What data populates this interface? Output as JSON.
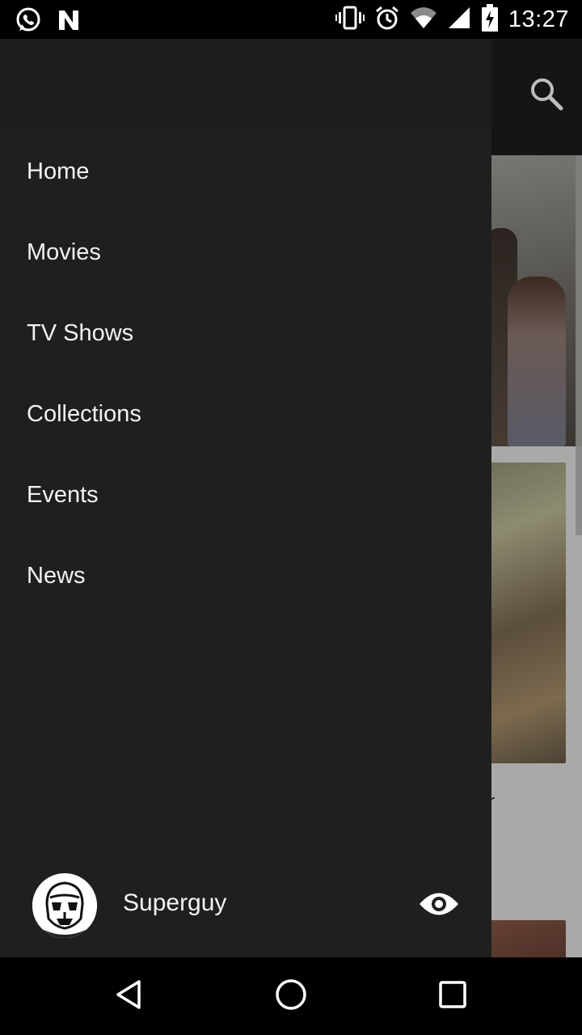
{
  "status_bar": {
    "time": "13:27",
    "icons": [
      "whatsapp-icon",
      "n-notification-icon",
      "vibrate-icon",
      "alarm-icon",
      "wifi-icon",
      "signal-icon",
      "battery-icon"
    ]
  },
  "toolbar": {
    "search_icon": "search-icon"
  },
  "background": {
    "partial_text": "r"
  },
  "drawer": {
    "menu_items": [
      {
        "label": "Home"
      },
      {
        "label": "Movies"
      },
      {
        "label": "TV Shows"
      },
      {
        "label": "Collections"
      },
      {
        "label": "Events"
      },
      {
        "label": "News"
      }
    ],
    "profile": {
      "name": "Superguy",
      "avatar_icon": "stormtrooper-avatar",
      "visibility_icon": "eye-icon"
    }
  },
  "nav_bar": {
    "buttons": [
      "back-icon",
      "home-icon",
      "recents-icon"
    ]
  },
  "colors": {
    "drawer_bg": "#1e1f1e",
    "toolbar_bg": "#141514",
    "text": "#f2f2f2"
  }
}
